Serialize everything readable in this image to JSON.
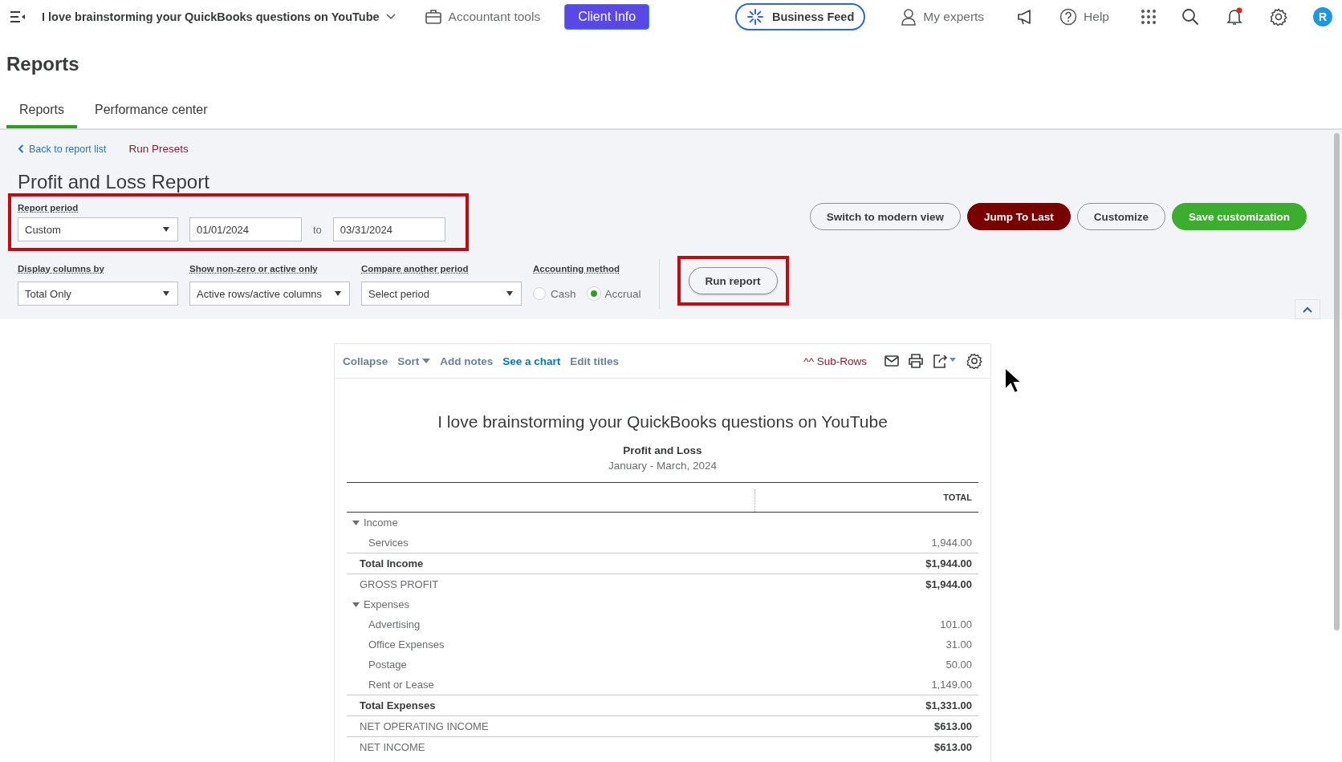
{
  "top_bar": {
    "company": "I love brainstorming your QuickBooks questions on YouTube",
    "accountant_tools": "Accountant tools",
    "client_info": "Client Info",
    "business_feed": "Business Feed",
    "my_experts": "My experts",
    "help": "Help",
    "avatar": "R",
    "notification_dot": true
  },
  "page_title": "Reports",
  "tabs": [
    {
      "label": "Reports",
      "selected": true
    },
    {
      "label": "Performance center",
      "selected": false
    }
  ],
  "breadcrumb": {
    "back": "Back to report list",
    "presets": "Run Presets"
  },
  "report_title": "Profit and Loss Report",
  "report_period": {
    "label": "Report period",
    "period": "Custom",
    "from": "01/01/2024",
    "separator": "to",
    "to": "03/31/2024"
  },
  "actions": [
    {
      "label": "Switch to modern view",
      "kind": "outline"
    },
    {
      "label": "Jump To Last",
      "kind": "dark"
    },
    {
      "label": "Customize",
      "kind": "outline"
    },
    {
      "label": "Save customization",
      "kind": "primary"
    }
  ],
  "filters": [
    {
      "label": "Display columns by",
      "value": "Total Only"
    },
    {
      "label": "Show non-zero or active only",
      "value": "Active rows/active columns"
    },
    {
      "label": "Compare another period",
      "value": "Select period"
    }
  ],
  "accounting_method": {
    "label": "Accounting method",
    "options": [
      {
        "label": "Cash",
        "selected": false
      },
      {
        "label": "Accrual",
        "selected": true
      }
    ]
  },
  "run_report": "Run report",
  "toolbar": {
    "links": [
      {
        "label": "Collapse",
        "kind": "muted"
      },
      {
        "label": "Sort",
        "kind": "dropdown"
      },
      {
        "label": "Add notes",
        "kind": "muted"
      },
      {
        "label": "See a chart",
        "kind": "accent"
      },
      {
        "label": "Edit titles",
        "kind": "muted"
      }
    ],
    "sub_rows": "^^ Sub-Rows"
  },
  "report": {
    "company": "I love brainstorming your QuickBooks questions on YouTube",
    "title": "Profit and Loss",
    "period": "January - March, 2024",
    "column": "TOTAL",
    "rows": [
      {
        "kind": "section",
        "label": "Income",
        "expanded": true,
        "children": [
          {
            "label": "Services",
            "amount": "1,944.00"
          }
        ]
      },
      {
        "kind": "total",
        "label": "Total Income",
        "amount": "$1,944.00"
      },
      {
        "kind": "summary",
        "label": "GROSS PROFIT",
        "amount": "$1,944.00"
      },
      {
        "kind": "section",
        "label": "Expenses",
        "expanded": true,
        "children": [
          {
            "label": "Advertising",
            "amount": "101.00"
          },
          {
            "label": "Office Expenses",
            "amount": "31.00"
          },
          {
            "label": "Postage",
            "amount": "50.00"
          },
          {
            "label": "Rent or Lease",
            "amount": "1,149.00"
          }
        ]
      },
      {
        "kind": "total",
        "label": "Total Expenses",
        "amount": "$1,331.00"
      },
      {
        "kind": "summary",
        "label": "NET OPERATING INCOME",
        "amount": "$613.00"
      },
      {
        "kind": "summary",
        "label": "NET INCOME",
        "amount": "$613.00"
      }
    ]
  }
}
